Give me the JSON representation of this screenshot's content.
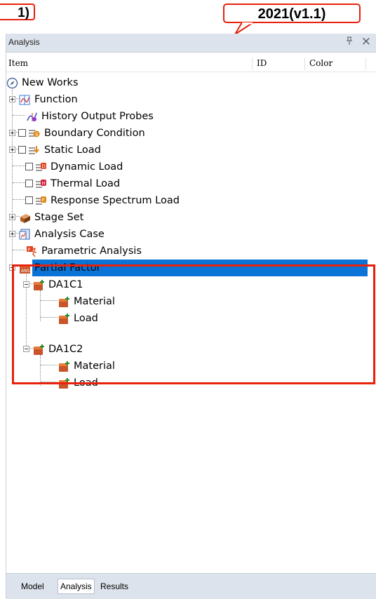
{
  "callouts": {
    "left": "1)",
    "right": "2021(v1.1)"
  },
  "panel": {
    "title": "Analysis",
    "pin": " ↓",
    "close": "×"
  },
  "columns": {
    "item": "Item",
    "id": "ID",
    "color": "Color"
  },
  "tree": {
    "root": "New Works",
    "function": "Function",
    "history_output_probes": "History Output Probes",
    "boundary_condition": "Boundary Condition",
    "static_load": "Static Load",
    "dynamic_load": "Dynamic Load",
    "thermal_load": "Thermal Load",
    "response_spectrum_load": "Response Spectrum Load",
    "stage_set": "Stage Set",
    "analysis_case": "Analysis Case",
    "parametric_analysis": "Parametric Analysis",
    "partial_factor": "Partial Factor",
    "da1c1": "DA1C1",
    "da1c1_material": "Material",
    "da1c1_load": "Load",
    "da1c2": "DA1C2",
    "da1c2_material": "Material",
    "da1c2_load": "Load"
  },
  "tabs": {
    "model": "Model",
    "analysis": "Analysis",
    "results": "Results"
  },
  "colors": {
    "highlight": "#e8200c",
    "selection": "#0a74d6",
    "panel_header": "#dde3ec"
  }
}
